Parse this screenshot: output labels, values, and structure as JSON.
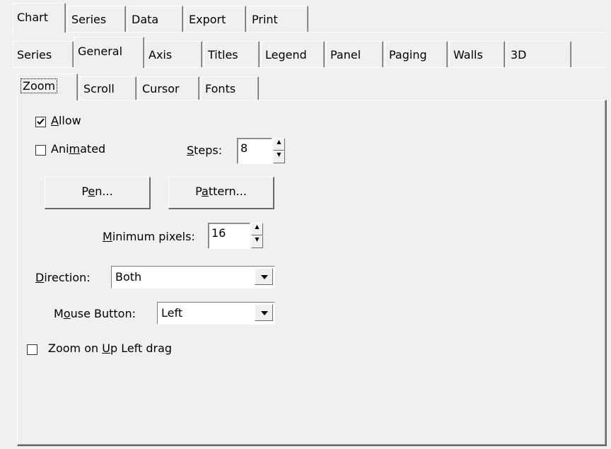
{
  "tabs_level1": [
    "Chart",
    "Series",
    "Data",
    "Export",
    "Print"
  ],
  "tabs_level2": [
    "Series",
    "General",
    "Axis",
    "Titles",
    "Legend",
    "Panel",
    "Paging",
    "Walls",
    "3D"
  ],
  "tabs_level3": [
    "Zoom",
    "Scroll",
    "Cursor",
    "Fonts"
  ],
  "active_tabs": {
    "level1": "Chart",
    "level2": "General",
    "level3": "Zoom"
  },
  "zoom": {
    "allow": {
      "label_u": "A",
      "label_rest": "llow",
      "checked": true
    },
    "animated": {
      "label_pre": "Ani",
      "label_u": "m",
      "label_rest": "ated",
      "checked": false
    },
    "steps": {
      "label_u": "S",
      "label_rest": "teps:",
      "value": "8"
    },
    "pen_button": {
      "pre": "P",
      "u": "e",
      "rest": "n..."
    },
    "pattern_button": {
      "pre": "P",
      "u": "a",
      "rest": "ttern..."
    },
    "minimum_pixels": {
      "label_u": "M",
      "label_rest": "inimum pixels:",
      "value": "16"
    },
    "direction": {
      "label_u": "D",
      "label_rest": "irection:",
      "value": "Both"
    },
    "mouse_button": {
      "label_pre": "M",
      "label_u": "o",
      "label_rest": "use Button:",
      "value": "Left"
    },
    "zoom_up_left": {
      "label_pre": "Zoom on ",
      "label_u": "U",
      "label_rest": "p Left drag",
      "checked": false
    }
  }
}
